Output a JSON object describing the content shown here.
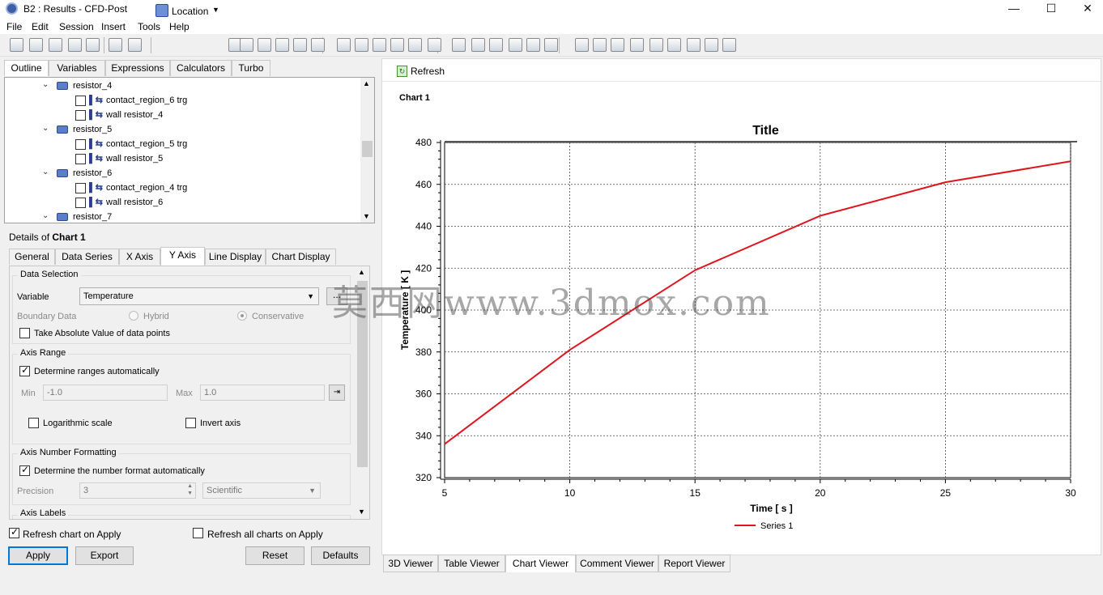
{
  "window": {
    "title": "B2 : Results - CFD-Post",
    "controls": [
      "—",
      "☐",
      "✕"
    ]
  },
  "menubar": [
    "File",
    "Edit",
    "Session",
    "Insert",
    "Tools",
    "Help"
  ],
  "toolbar": {
    "location_label": "Location",
    "icons": [
      "new-icon",
      "open-icon",
      "save-icon",
      "reload-icon",
      "screenshot-icon",
      "undo-icon",
      "redo-icon",
      "location-icon",
      "vector-icon",
      "contour-icon",
      "streamline-icon",
      "particle-icon",
      "volume-icon",
      "isosurface-icon",
      "plane-icon",
      "line-icon",
      "point-icon",
      "polyline-icon",
      "surface-icon",
      "colormap-icon",
      "expression-icon",
      "variable-icon",
      "table-icon",
      "chart-icon",
      "text-icon",
      "legend-icon",
      "timestep-icon",
      "animation-icon",
      "quickeditor-icon",
      "probe-icon",
      "function-icon",
      "mesh-icon",
      "macro-icon",
      "case-icon",
      "command-icon"
    ]
  },
  "outline_tabs": [
    "Outline",
    "Variables",
    "Expressions",
    "Calculators",
    "Turbo"
  ],
  "tree": [
    {
      "level": 0,
      "type": "group",
      "label": "resistor_4"
    },
    {
      "level": 1,
      "type": "bc",
      "label": "contact_region_6 trg"
    },
    {
      "level": 1,
      "type": "bc",
      "label": "wall resistor_4"
    },
    {
      "level": 0,
      "type": "group",
      "label": "resistor_5"
    },
    {
      "level": 1,
      "type": "bc",
      "label": "contact_region_5 trg"
    },
    {
      "level": 1,
      "type": "bc",
      "label": "wall resistor_5"
    },
    {
      "level": 0,
      "type": "group",
      "label": "resistor_6"
    },
    {
      "level": 1,
      "type": "bc",
      "label": "contact_region_4 trg"
    },
    {
      "level": 1,
      "type": "bc",
      "label": "wall resistor_6"
    },
    {
      "level": 0,
      "type": "group",
      "label": "resistor_7"
    }
  ],
  "details": {
    "prefix": "Details of ",
    "object": "Chart 1",
    "tabs": [
      "General",
      "Data Series",
      "X Axis",
      "Y Axis",
      "Line Display",
      "Chart Display"
    ],
    "active_tab": "Y Axis",
    "data_selection": {
      "group": "Data Selection",
      "variable_label": "Variable",
      "variable_value": "Temperature",
      "more_button": "...",
      "boundary_label": "Boundary Data",
      "hybrid": "Hybrid",
      "conservative": "Conservative",
      "abs_label": "Take Absolute Value of data points"
    },
    "axis_range": {
      "group": "Axis Range",
      "auto_label": "Determine ranges automatically",
      "min_label": "Min",
      "min_value": "-1.0",
      "max_label": "Max",
      "max_value": "1.0",
      "log_label": "Logarithmic scale",
      "invert_label": "Invert axis"
    },
    "number_format": {
      "group": "Axis Number Formatting",
      "auto_label": "Determine the number format automatically",
      "precision_label": "Precision",
      "precision_value": "3",
      "format_value": "Scientific"
    },
    "axis_labels": {
      "group": "Axis Labels"
    },
    "refresh_chart": "Refresh chart on Apply",
    "refresh_all": "Refresh all charts on Apply",
    "buttons": {
      "apply": "Apply",
      "export": "Export",
      "reset": "Reset",
      "defaults": "Defaults"
    }
  },
  "viewer": {
    "refresh_label": "Refresh",
    "chart_name": "Chart 1",
    "tabs": [
      "3D Viewer",
      "Table Viewer",
      "Chart Viewer",
      "Comment Viewer",
      "Report Viewer"
    ],
    "active_tab": "Chart Viewer"
  },
  "watermark": "莫西网www.3dmox.com",
  "colors": {
    "series": "#e0141e",
    "accent": "#0078d7"
  },
  "chart_data": {
    "type": "line",
    "title": "Title",
    "xlabel": "Time [ s ]",
    "ylabel": "Temperature [ K ]",
    "xlim": [
      5,
      30
    ],
    "ylim": [
      320,
      480
    ],
    "xticks": [
      5,
      10,
      15,
      20,
      25,
      30
    ],
    "yticks": [
      320,
      340,
      360,
      380,
      400,
      420,
      440,
      460,
      480
    ],
    "grid": true,
    "legend_position": "bottom",
    "series": [
      {
        "name": "Series 1",
        "x": [
          5,
          10,
          15,
          20,
          25,
          30
        ],
        "y": [
          336,
          381,
          419,
          445,
          461,
          471
        ]
      }
    ]
  }
}
